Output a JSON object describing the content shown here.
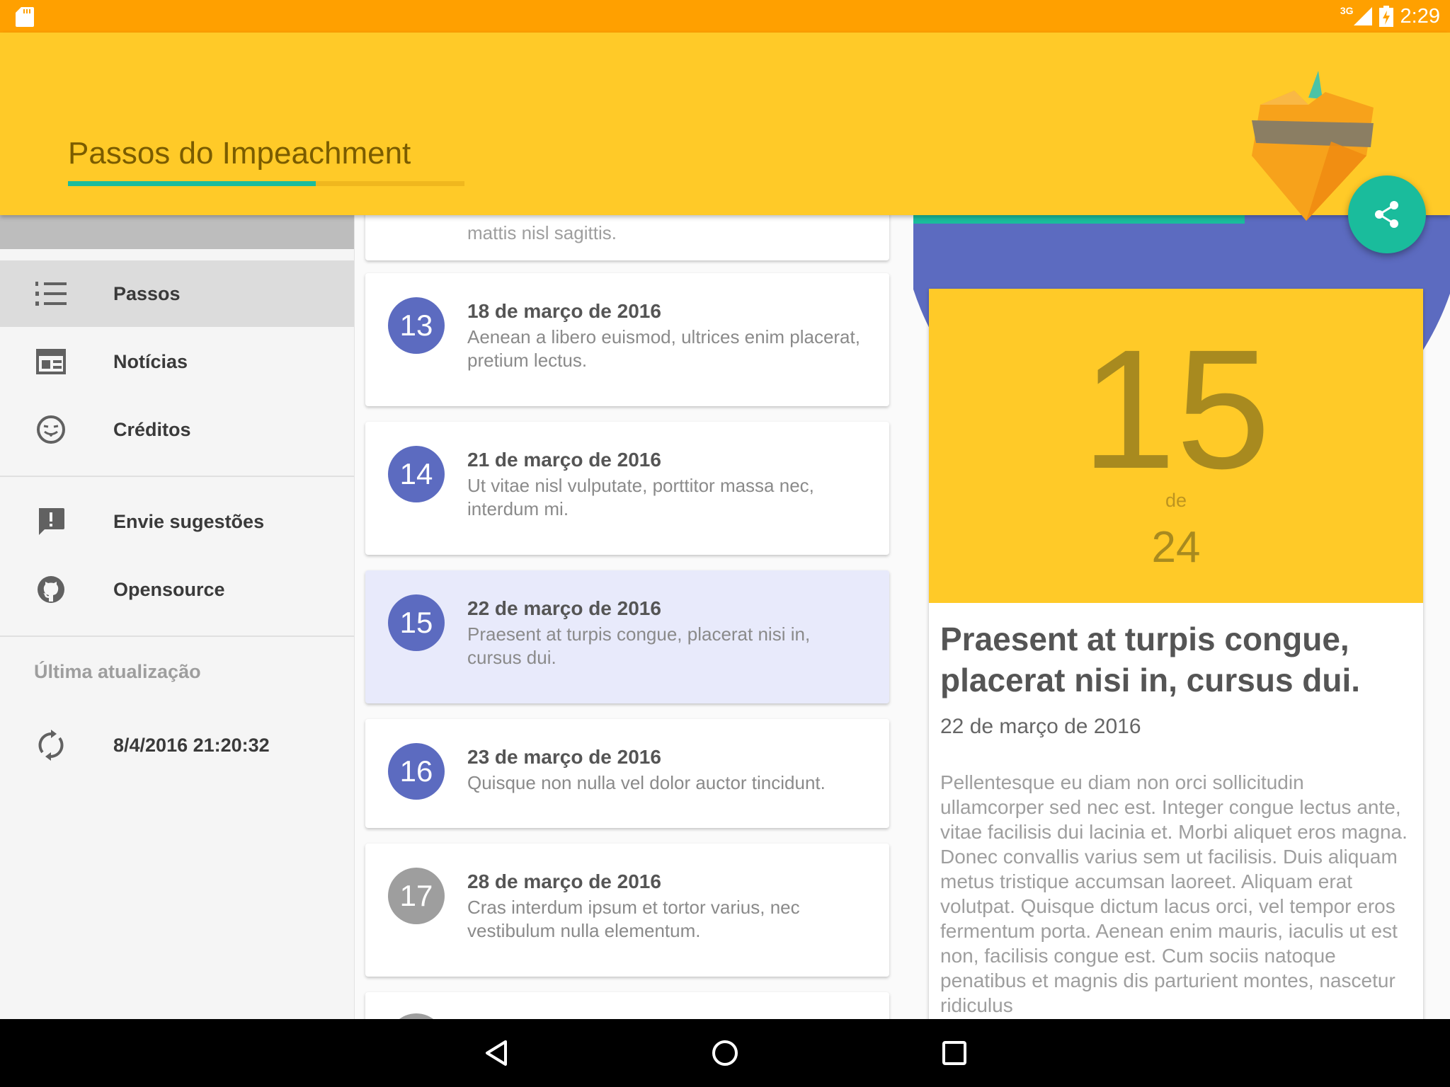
{
  "status_bar": {
    "network_label": "3G",
    "time": "2:29",
    "icons": [
      "sd-card-icon",
      "signal-icon",
      "battery-charging-icon"
    ]
  },
  "app_bar": {
    "title": "Passos do Impeachment",
    "progress_fraction": 0.625,
    "logo_icon": "heart-logo-icon",
    "share_icon": "share-icon"
  },
  "drawer": {
    "items": [
      {
        "label": "Passos",
        "icon": "list-numbered-icon",
        "active": true
      },
      {
        "label": "Notícias",
        "icon": "newspaper-icon",
        "active": false
      },
      {
        "label": "Créditos",
        "icon": "emoticon-tongue-icon",
        "active": false
      },
      {
        "label": "Envie sugestões",
        "icon": "feedback-icon",
        "active": false
      },
      {
        "label": "Opensource",
        "icon": "github-icon",
        "active": false
      }
    ],
    "last_update_label": "Última atualização",
    "last_update_value": "8/4/2016 21:20:32",
    "sync_icon": "sync-icon"
  },
  "steps": {
    "partial_top_text": "mattis nisl sagittis.",
    "cards": [
      {
        "number": "13",
        "date": "18 de março de 2016",
        "desc": "Aenean a libero euismod, ultrices enim placerat, pretium lectus.",
        "selected": false,
        "done": true
      },
      {
        "number": "14",
        "date": "21 de março de 2016",
        "desc": "Ut vitae nisl vulputate, porttitor massa nec, interdum mi.",
        "selected": false,
        "done": true
      },
      {
        "number": "15",
        "date": "22 de março de 2016",
        "desc": "Praesent at turpis congue, placerat nisi in, cursus dui.",
        "selected": true,
        "done": true
      },
      {
        "number": "16",
        "date": "23 de março de 2016",
        "desc": "Quisque non nulla vel dolor auctor tincidunt.",
        "selected": false,
        "done": true
      },
      {
        "number": "17",
        "date": "28 de março de 2016",
        "desc": "Cras interdum ipsum et tortor varius, nec vestibulum nulla elementum.",
        "selected": false,
        "done": false
      }
    ]
  },
  "detail": {
    "current": "15",
    "of_label": "de",
    "total": "24",
    "title": "Praesent at turpis congue, placerat nisi in, cursus dui.",
    "date": "22 de março de 2016",
    "body": "Pellentesque eu diam non orci sollicitudin ullamcorper sed nec est. Integer congue lectus ante, vitae facilisis dui lacinia et. Morbi aliquet eros magna. Donec convallis varius sem ut facilisis. Duis aliquam metus tristique accumsan laoreet. Aliquam erat volutpat. Quisque dictum lacus orci, vel tempor eros fermentum porta. Aenean enim mauris, iaculis ut est non, facilisis congue est. Cum sociis natoque penatibus et magnis dis parturient montes, nascetur ridiculus"
  },
  "colors": {
    "status_bar": "#ffa000",
    "app_bar": "#ffca28",
    "accent_teal": "#1abc9c",
    "indigo": "#5c6bc0",
    "selected_card": "#e8eafb"
  },
  "nav_buttons": [
    "back-icon",
    "home-icon",
    "recents-icon"
  ]
}
